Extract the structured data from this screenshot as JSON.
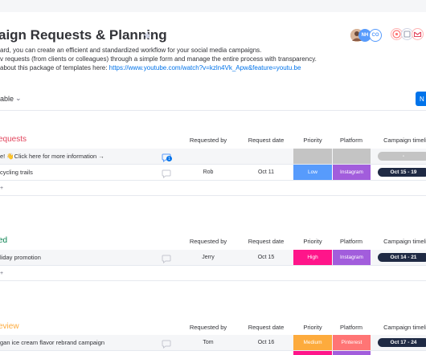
{
  "board": {
    "title": "aign Requests & Planning",
    "description": [
      "ard, you can create an efficient and standardized workflow for your social media campaigns.",
      "v requests (from clients or colleagues) through a simple form and manage the entire process with transparency.",
      "about this package of templates here: "
    ],
    "link": "https://www.youtube.com/watch?v=kzln4Vk_Apw&feature=youtu.be"
  },
  "avatars": [
    "NH",
    "CO"
  ],
  "toolbar": {
    "view_label": "able",
    "new_label": "N"
  },
  "columns": [
    "Requested by",
    "Request date",
    "Priority",
    "Platform",
    "Campaign timeli"
  ],
  "colors": {
    "group_requests": "#e2445c",
    "group_approved": "#037f4c",
    "group_review": "#fdab3d",
    "priority_low": "#579bfc",
    "priority_high": "#ff158a",
    "priority_medium": "#fdab3d",
    "platform_instagram": "#a25ddc",
    "platform_pinterest": "#ff7575",
    "timeline_dark": "#1f2a44"
  },
  "groups": [
    {
      "name": "equests",
      "color": "#e2445c",
      "rows": [
        {
          "item": "e! 👋Click here for more information →",
          "requested_by": "",
          "date": "",
          "priority": "",
          "platform": "",
          "timeline": "-"
        },
        {
          "item": "cycling trails",
          "requested_by": "Rob",
          "date": "Oct 11",
          "priority": "Low",
          "platform": "Instagram",
          "timeline": "Oct 15 - 19"
        }
      ]
    },
    {
      "name": "ed",
      "color": "#037f4c",
      "rows": [
        {
          "item": "liday promotion",
          "requested_by": "Jerry",
          "date": "Oct 15",
          "priority": "High",
          "platform": "Instagram",
          "timeline": "Oct 14 - 21"
        }
      ]
    },
    {
      "name": "eview",
      "color": "#fdab3d",
      "rows": [
        {
          "item": "gan ice cream flavor rebrand campaign",
          "requested_by": "Tom",
          "date": "Oct 16",
          "priority": "Medium",
          "platform": "Pinterest",
          "timeline": "Oct 17 - 24"
        }
      ]
    }
  ]
}
